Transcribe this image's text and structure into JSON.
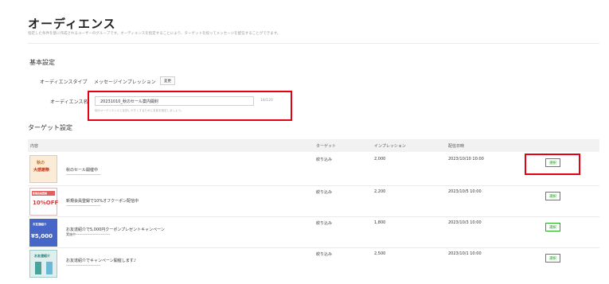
{
  "page": {
    "title": "オーディエンス",
    "subtitle": "指定した条件を基に作成されるユーザーのグループです。オーディエンスを指定することにより、ターゲットを絞ってメッセージを配信することができます。"
  },
  "basic": {
    "heading": "基本設定",
    "audience_type_label": "オーディエンスタイプ",
    "audience_type_value": "メッセージインプレッション",
    "change_label": "変更",
    "audience_name_label": "オーディエンス名",
    "audience_name_value": "20231010_秋のセール案内開封",
    "counter": "18/120",
    "help": "他のオーディエンスと区別しやすくするために名前を設定しましょう。"
  },
  "target": {
    "heading": "ターゲット設定",
    "columns": [
      "内容",
      "ターゲット",
      "インプレッション",
      "配信日時"
    ],
    "rows": [
      {
        "thumb_line1": "秋の",
        "thumb_line2": "大感謝祭",
        "title": "秋のセール開催中",
        "subtitle": "------------------------------",
        "target": "絞り込み",
        "impressions": "2,000",
        "date": "2023/10/10 10:00",
        "select_label": "選択"
      },
      {
        "thumb_line1": "新規会員登録",
        "thumb_line2": "10%OFF",
        "title": "新規会員登録で10%オフクーポン配信中",
        "subtitle": "------------------------------",
        "target": "絞り込み",
        "impressions": "2,200",
        "date": "2023/10/5 10:00",
        "select_label": "選択"
      },
      {
        "thumb_line1": "お友達紹介",
        "thumb_line2": "¥5,000",
        "title": "お友達紹介で5,000円クーポンプレゼントキャンペーン",
        "subtitle": "実施中------------------------------",
        "target": "絞り込み",
        "impressions": "1,800",
        "date": "2023/10/3 10:00",
        "select_label": "選択"
      },
      {
        "thumb_line1": "お友達紹介",
        "thumb_line2": "",
        "title": "お友達紹介でキャンペーン開催します♪",
        "subtitle": "------------------------------",
        "target": "絞り込み",
        "impressions": "2,500",
        "date": "2023/10/1 10:00",
        "select_label": "選択"
      }
    ]
  },
  "colors": {
    "highlight": "#e60012",
    "select_green": "#20b020"
  }
}
